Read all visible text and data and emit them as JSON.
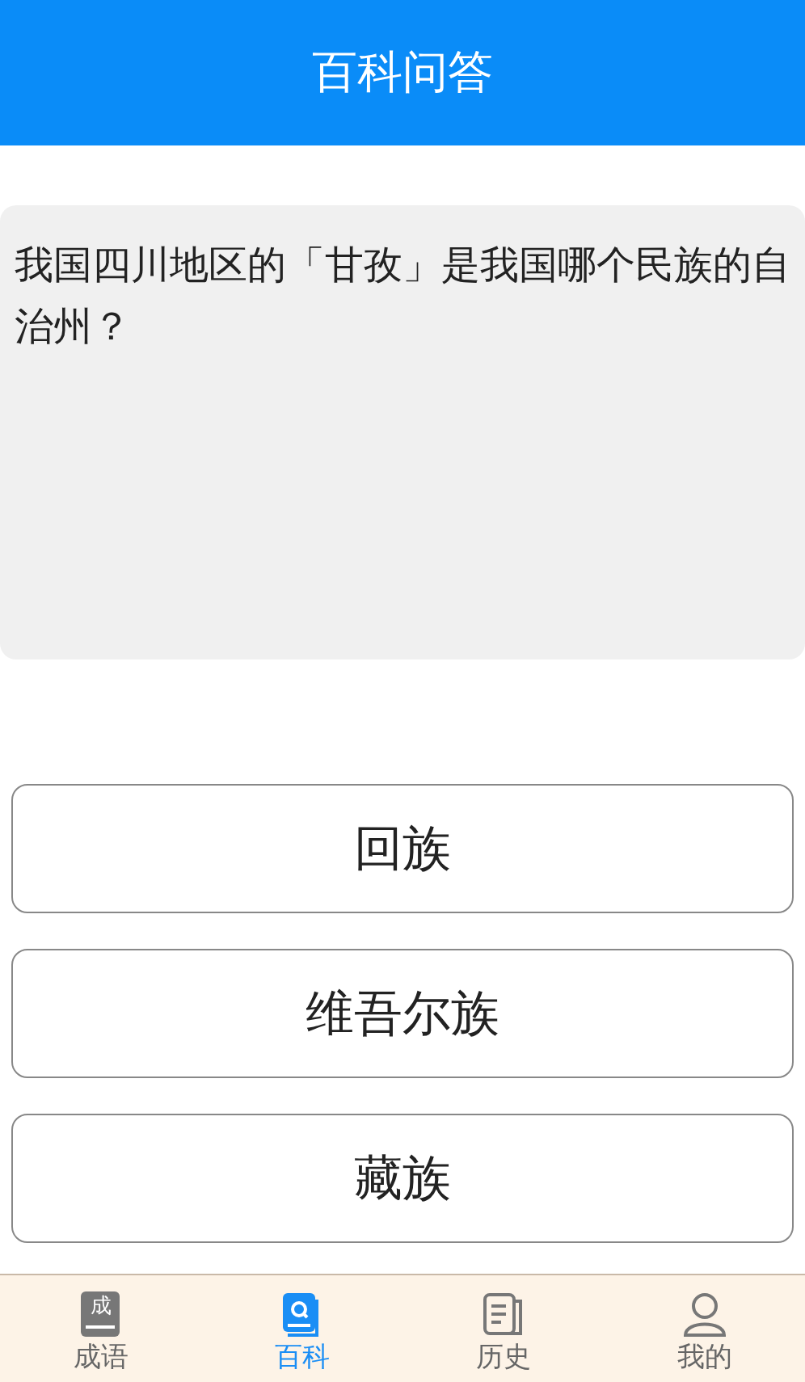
{
  "header": {
    "title": "百科问答"
  },
  "question": "我国四川地区的「甘孜」是我国哪个民族的自治州？",
  "options": [
    {
      "label": "回族"
    },
    {
      "label": "维吾尔族"
    },
    {
      "label": "藏族"
    }
  ],
  "tabs": [
    {
      "label": "成语",
      "kind": "idiom",
      "icon_text": "成",
      "selected": false
    },
    {
      "label": "百科",
      "kind": "encyclopedia",
      "selected": true
    },
    {
      "label": "历史",
      "kind": "history",
      "selected": false
    },
    {
      "label": "我的",
      "kind": "profile",
      "selected": false
    }
  ]
}
